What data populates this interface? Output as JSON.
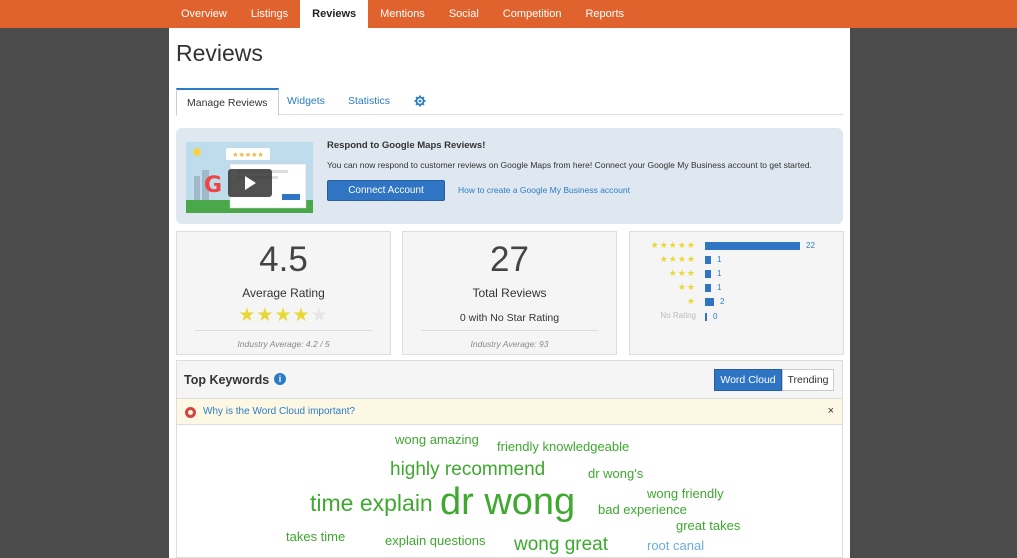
{
  "topnav": {
    "tabs": [
      "Overview",
      "Listings",
      "Reviews",
      "Mentions",
      "Social",
      "Competition",
      "Reports"
    ],
    "active": "Reviews"
  },
  "page": {
    "title": "Reviews"
  },
  "subtabs": {
    "manage": "Manage Reviews",
    "widgets": "Widgets",
    "statistics": "Statistics",
    "settings_icon": "gear-icon"
  },
  "banner": {
    "title": "Respond to Google Maps Reviews!",
    "text": "You can now respond to customer reviews on Google Maps from here! Connect your Google My Business account to get started.",
    "button": "Connect Account",
    "link": "How to create a Google My Business account"
  },
  "rating": {
    "value": "4.5",
    "label": "Average Rating",
    "stars_filled": 4,
    "stars_total": 5,
    "industry": "Industry Average: 4.2 / 5"
  },
  "total": {
    "value": "27",
    "label": "Total Reviews",
    "no_star": "0 with No Star Rating",
    "industry": "Industry Average: 93"
  },
  "distribution": [
    {
      "stars": "★★★★★",
      "count": "22",
      "value": 22
    },
    {
      "stars": "★★★★",
      "count": "1",
      "value": 1
    },
    {
      "stars": "★★★",
      "count": "1",
      "value": 1
    },
    {
      "stars": "★★",
      "count": "1",
      "value": 1
    },
    {
      "stars": "★",
      "count": "2",
      "value": 2
    },
    {
      "stars": "No Rating",
      "count": "0",
      "value": 0
    }
  ],
  "keywords": {
    "title": "Top Keywords",
    "info_icon": "info-icon",
    "toggle_on": "Word Cloud",
    "toggle_off": "Trending",
    "why": "Why is the Word Cloud important?",
    "close": "×",
    "words": [
      "wong amazing",
      "friendly knowledgeable",
      "highly recommend",
      "dr wong's",
      "time explain",
      "dr wong",
      "wong friendly",
      "bad experience",
      "great takes",
      "takes time",
      "explain questions",
      "wong great",
      "root canal"
    ]
  },
  "colors": {
    "nav": "#e0632e",
    "accent": "#2f75c3",
    "cloud_green": "#3ea82f",
    "cloud_blue": "#6aaed8",
    "star": "#e8d837"
  }
}
